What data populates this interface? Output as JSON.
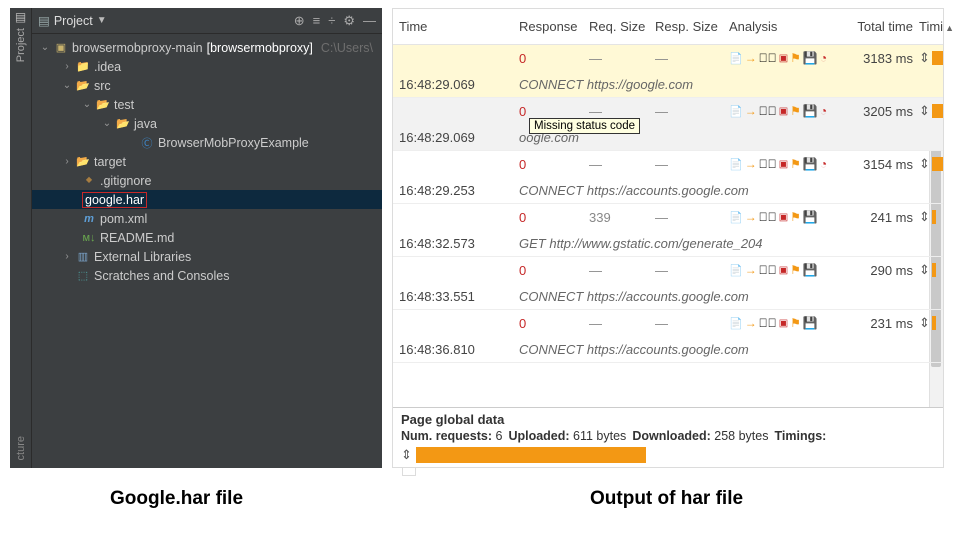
{
  "ide": {
    "sidebar_tab": "Project",
    "sidebar_tab_bottom": "cture",
    "toolbar_label": "Project",
    "root": {
      "name": "browsermobproxy-main",
      "qualifier": "[browsermobproxy]",
      "path": "C:\\Users\\"
    },
    "nodes": {
      "idea": ".idea",
      "src": "src",
      "test": "test",
      "java": "java",
      "example": "BrowserMobProxyExample",
      "target": "target",
      "gitignore": ".gitignore",
      "googlehar": "google.har",
      "pom": "pom.xml",
      "readme": "README.md",
      "extlib": "External Libraries",
      "scratch": "Scratches and Consoles"
    }
  },
  "har": {
    "columns": {
      "time": "Time",
      "resp": "Response",
      "req": "Req. Size",
      "respsize": "Resp. Size",
      "analysis": "Analysis",
      "total": "Total time",
      "timi": "Timi"
    },
    "tooltip": "Missing status code",
    "rows": [
      {
        "time": "16:48:29.069",
        "resp": "0",
        "req": "—",
        "respsize": "—",
        "total": "3183 ms",
        "desc": "CONNECT https://google.com",
        "hasClock": true
      },
      {
        "time": "16:48:29.069",
        "resp": "0",
        "req": "—",
        "respsize": "—",
        "total": "3205 ms",
        "desc": "oogle.com",
        "hasClock": true
      },
      {
        "time": "16:48:29.253",
        "resp": "0",
        "req": "—",
        "respsize": "—",
        "total": "3154 ms",
        "desc": "CONNECT https://accounts.google.com",
        "hasClock": true
      },
      {
        "time": "16:48:32.573",
        "resp": "0",
        "req": "339",
        "respsize": "—",
        "total": "241 ms",
        "desc": "GET http://www.gstatic.com/generate_204",
        "hasClock": false
      },
      {
        "time": "16:48:33.551",
        "resp": "0",
        "req": "—",
        "respsize": "—",
        "total": "290 ms",
        "desc": "CONNECT https://accounts.google.com",
        "hasClock": false
      },
      {
        "time": "16:48:36.810",
        "resp": "0",
        "req": "—",
        "respsize": "—",
        "total": "231 ms",
        "desc": "CONNECT https://accounts.google.com",
        "hasClock": false
      }
    ],
    "global": {
      "title": "Page global data",
      "numreq_label": "Num. requests:",
      "numreq": "6",
      "upload_label": "Uploaded:",
      "upload": "611 bytes",
      "download_label": "Downloaded:",
      "download": "258 bytes",
      "timings_label": "Timings:"
    }
  },
  "captions": {
    "left": "Google.har file",
    "right": "Output of har file"
  }
}
